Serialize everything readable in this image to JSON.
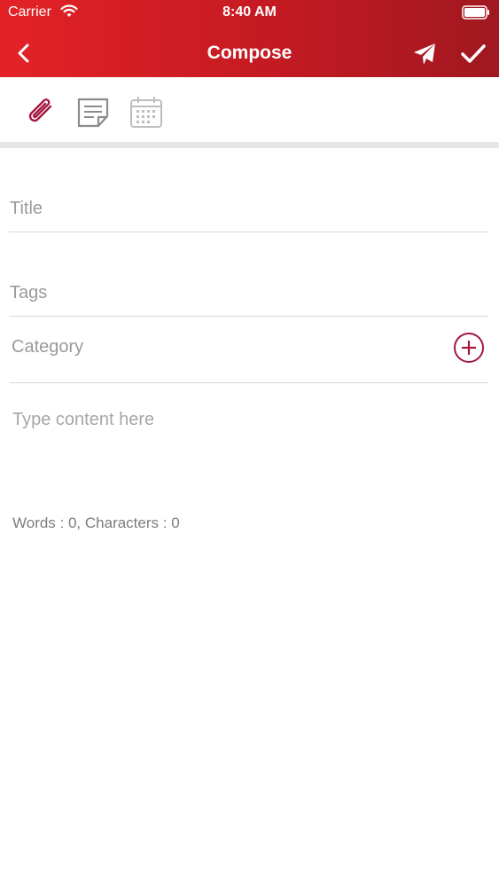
{
  "status_bar": {
    "carrier": "Carrier",
    "time": "8:40 AM",
    "icons": [
      "wifi-icon",
      "battery-icon"
    ]
  },
  "nav": {
    "title": "Compose",
    "back_icon": "chevron-left-icon",
    "send_icon": "paper-plane-icon",
    "done_icon": "checkmark-icon"
  },
  "toolbar": {
    "tools": [
      "paperclip-icon",
      "note-icon",
      "calendar-icon"
    ],
    "active_color": "#a3173f",
    "inactive_color": "#8c8c8c"
  },
  "form": {
    "title_placeholder": "Title",
    "tags_placeholder": "Tags",
    "category_placeholder": "Category",
    "add_category_icon": "plus-circle-icon",
    "content_placeholder": "Type content here",
    "word_count": "Words : 0, Characters : 0"
  },
  "colors": {
    "header_start": "#e32226",
    "header_end": "#a01820",
    "accent": "#a3173f"
  }
}
